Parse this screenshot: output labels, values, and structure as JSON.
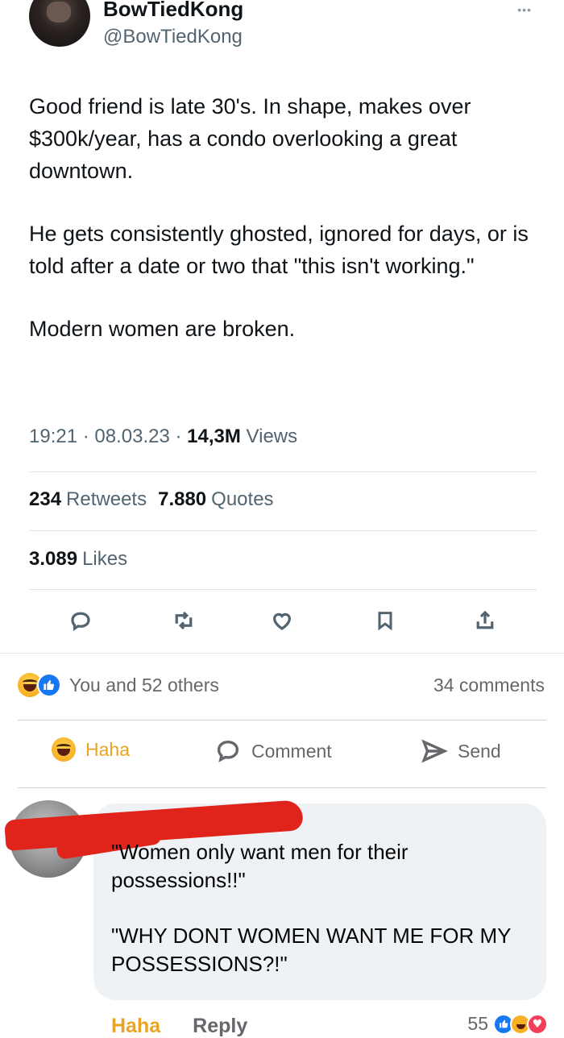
{
  "tweet": {
    "author_name": "BowTiedKong",
    "author_handle": "@BowTiedKong",
    "more_glyph": "•••",
    "paragraphs": [
      "Good friend is late 30's. In shape, makes over $300k/year, has a condo overlooking a great downtown.",
      "He gets consistently ghosted, ignored for days, or is told after a date or two that \"this isn't working.\"",
      "Modern women are broken."
    ],
    "time": "19:21",
    "date": "08.03.23",
    "views_count": "14,3M",
    "views_label": "Views",
    "retweets_count": "234",
    "retweets_label": "Retweets",
    "quotes_count": "7.880",
    "quotes_label": "Quotes",
    "likes_count": "3.089",
    "likes_label": "Likes",
    "action_icons": [
      "reply-icon",
      "retweet-icon",
      "like-icon",
      "bookmark-icon",
      "share-icon"
    ],
    "icon_color": "#536471"
  },
  "facebook": {
    "reactions_text": "You and 52 others",
    "comments_count": "34 comments",
    "actions": {
      "haha": "Haha",
      "comment": "Comment",
      "send": "Send"
    },
    "comment": {
      "paragraphs": [
        "\"Women only want men for their possessions!!\"",
        "\"WHY DONT WOMEN WANT ME FOR MY POSSESSIONS?!\""
      ],
      "haha_label": "Haha",
      "reply_label": "Reply",
      "reaction_count": "55"
    },
    "colors": {
      "haha": "#e9a424",
      "like": "#1877f2",
      "love": "#f33e58",
      "redaction": "#e0241c",
      "bubble": "#eff2f5"
    }
  }
}
